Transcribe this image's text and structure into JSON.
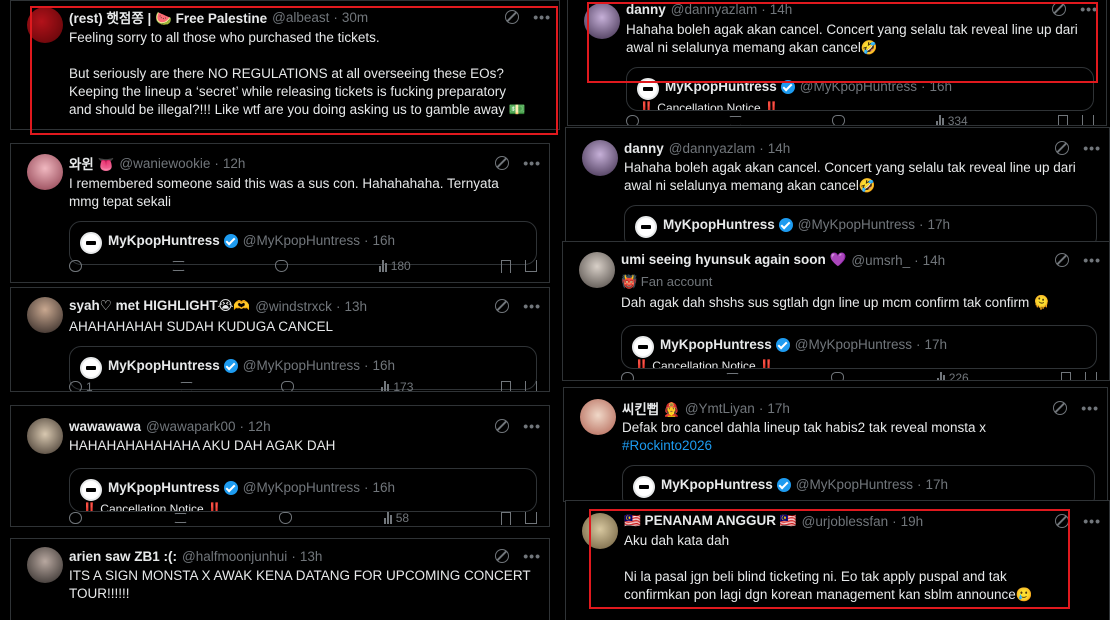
{
  "q": {
    "name": "MyKpopHuntress",
    "handle": "@MyKpopHuntress",
    "sub": "‼️ Cancellation Notice ‼️"
  },
  "tweets": [
    {
      "name": "(rest) 햇점쫑 | 🍉 Free Palestine",
      "handle": "@albeast",
      "time": "30m",
      "lines": [
        "Feeling sorry to all those who purchased the tickets.",
        "",
        "But seriously are there NO REGULATIONS at all overseeing these EOs?",
        "Keeping the lineup a ‘secret’ while releasing tickets is fucking preparatory",
        "and should be illegal?!!! Like wtf are you doing asking us to gamble away 💵"
      ]
    },
    {
      "name": "와윈 👅",
      "handle": "@waniewookie",
      "time": "12h",
      "lines": [
        "I remembered someone said this was a sus con. Hahahahaha. Ternyata",
        "mmg tepat sekali"
      ],
      "q_time": "16h",
      "views": "180"
    },
    {
      "name": "syah♡ met HIGHLIGHT😭🫶",
      "handle": "@windstrxck",
      "time": "13h",
      "lines": [
        "AHAHAHAHAH SUDAH KUDUGA CANCEL"
      ],
      "q_time": "16h",
      "reply_count": "1",
      "views": "173"
    },
    {
      "name": "wawawawa",
      "handle": "@wawapark00",
      "time": "12h",
      "lines": [
        "HAHAHAHAHAHAHA AKU DAH AGAK DAH"
      ],
      "q_time": "16h",
      "views": "58"
    },
    {
      "name": "arien saw ZB1 :(:",
      "handle": "@halfmoonjunhui",
      "time": "13h",
      "lines": [
        "ITS A SIGN MONSTA X AWAK KENA DATANG FOR UPCOMING CONCERT",
        "TOUR!!!!!!"
      ]
    },
    {
      "name": "danny",
      "handle": "@dannyazlam",
      "time": "14h",
      "lines": [
        "Hahaha boleh agak akan cancel. Concert yang selalu tak reveal line up dari",
        "awal ni selalunya memang akan cancel🤣"
      ],
      "q_time": "16h",
      "views": "334"
    },
    {
      "name": "danny",
      "handle": "@dannyazlam",
      "time": "14h",
      "lines": [
        "Hahaha boleh agak akan cancel. Concert yang selalu tak reveal line up dari",
        "awal ni selalunya memang akan cancel🤣"
      ],
      "q_time": "17h"
    },
    {
      "name": "umi seeing hyunsuk again soon 💜",
      "handle": "@umsrh_",
      "time": "14h",
      "label": "👹 Fan account",
      "lines": [
        "Dah agak dah shshs sus sgtlah dgn line up mcm confirm tak confirm 🫠"
      ],
      "q_time": "17h",
      "views": "226"
    },
    {
      "name": "씨킨뻡 👩‍🚒",
      "handle": "@YmtLiyan",
      "time": "17h",
      "lines": [
        "Defak bro cancel dahla lineup tak habis2 tak reveal monsta x"
      ],
      "hashtag": "#Rockinto2026",
      "q_time": "17h"
    },
    {
      "name": "🇲🇾 PENANAM ANGGUR 🇲🇾",
      "handle": "@urjoblessfan",
      "time": "19h",
      "lines": [
        "Aku dah kata dah",
        "",
        "Ni la pasal jgn beli blind ticketing ni. Eo tak apply puspal and tak",
        "confirmkan pon lagi dgn korean management kan sblm announce🥲"
      ]
    }
  ],
  "colors": {
    "bg": "#000000",
    "text": "#e7e9ea",
    "muted": "#71767b",
    "link": "#1d9bf0",
    "highlight": "#e0191e"
  }
}
